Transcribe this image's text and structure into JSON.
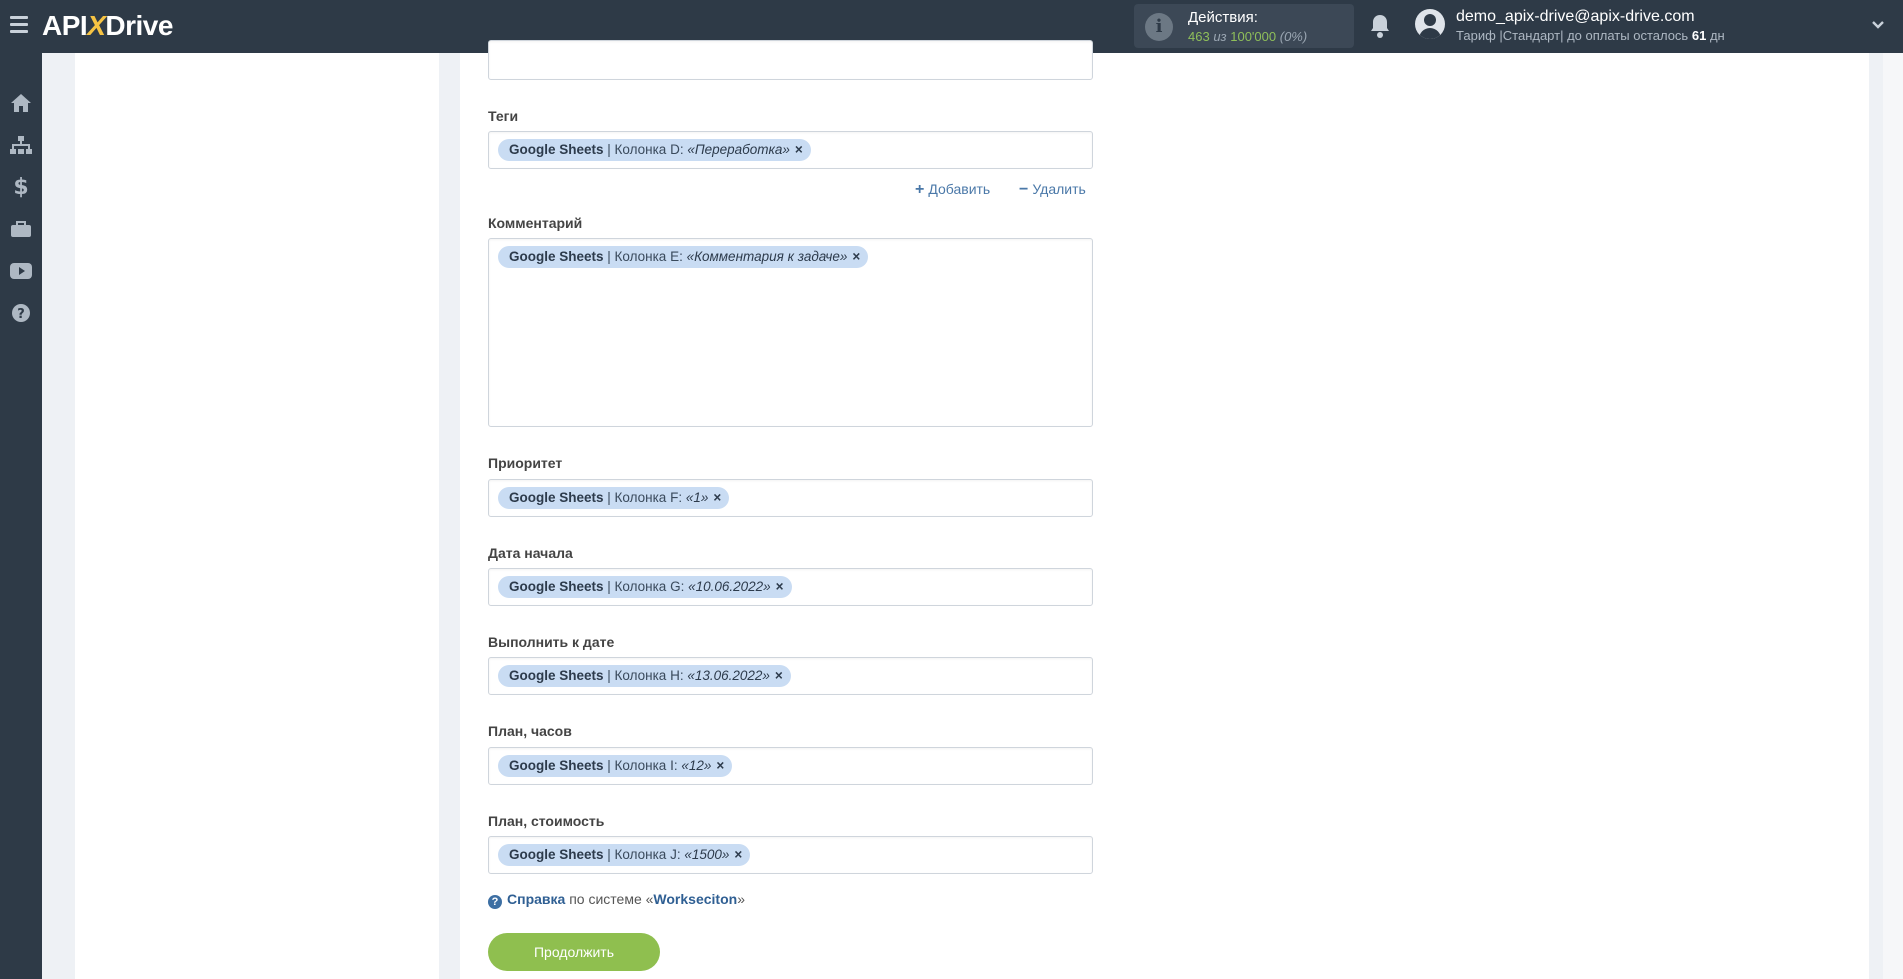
{
  "header": {
    "logo_left": "API",
    "logo_x": "X",
    "logo_right": "Drive",
    "actions_label": "Действия:",
    "actions_used": "463",
    "actions_sep": "из",
    "actions_total": "100'000",
    "actions_pct": "(0%)",
    "user_email": "demo_apix-drive@apix-drive.com",
    "plan_prefix": "Тариф |Стандарт| до оплаты осталось",
    "plan_days": "61",
    "plan_suffix": "дн"
  },
  "sidebar": {
    "items": [
      "home-icon",
      "sitemap-icon",
      "dollar-icon",
      "briefcase-icon",
      "youtube-icon",
      "help-icon"
    ]
  },
  "fields": [
    {
      "label": "Теги",
      "source": "Google Sheets",
      "column": " | Колонка D: ",
      "value": "«Переработка»"
    },
    {
      "label": "Комментарий",
      "source": "Google Sheets",
      "column": " | Колонка E: ",
      "value": "«Комментария к задаче»"
    },
    {
      "label": "Приоритет",
      "source": "Google Sheets",
      "column": " | Колонка F: ",
      "value": "«1»"
    },
    {
      "label": "Дата начала",
      "source": "Google Sheets",
      "column": " | Колонка G: ",
      "value": "«10.06.2022»"
    },
    {
      "label": "Выполнить к дате",
      "source": "Google Sheets",
      "column": " | Колонка H: ",
      "value": "«13.06.2022»"
    },
    {
      "label": "План, часов",
      "source": "Google Sheets",
      "column": " | Колонка I: ",
      "value": "«12»"
    },
    {
      "label": "План, стоимость",
      "source": "Google Sheets",
      "column": " | Колонка J: ",
      "value": "«1500»"
    }
  ],
  "tag_actions": {
    "add": "Добавить",
    "remove": "Удалить"
  },
  "chip_remove": "×",
  "help": {
    "link": "Справка",
    "middle": "по системе «",
    "system": "Workseciton",
    "end": "»"
  },
  "continue_label": "Продолжить",
  "colors": {
    "topbar": "#2e3a47",
    "chip": "#c9dcf3",
    "accent_green": "#8fbf4f",
    "link": "#4a78a8"
  }
}
